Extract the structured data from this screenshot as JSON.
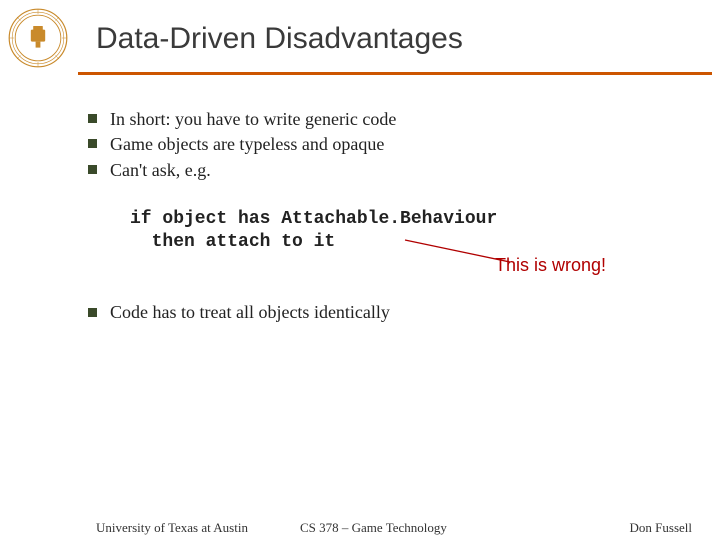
{
  "title": "Data-Driven Disadvantages",
  "bullets_top": [
    "In short: you have to write generic code",
    "Game objects are typeless and opaque",
    "Can't ask, e.g."
  ],
  "code": {
    "line1": "if object has Attachable.Behaviour",
    "line2": "  then attach to it"
  },
  "annotation": "This is wrong!",
  "bullets_bottom": [
    "Code has to treat all objects identically"
  ],
  "footer": {
    "left": "University of Texas at Austin",
    "center": "CS 378 – Game Technology",
    "right": "Don Fussell"
  },
  "colors": {
    "accent": "#cc5500",
    "annotation": "#b00000"
  }
}
